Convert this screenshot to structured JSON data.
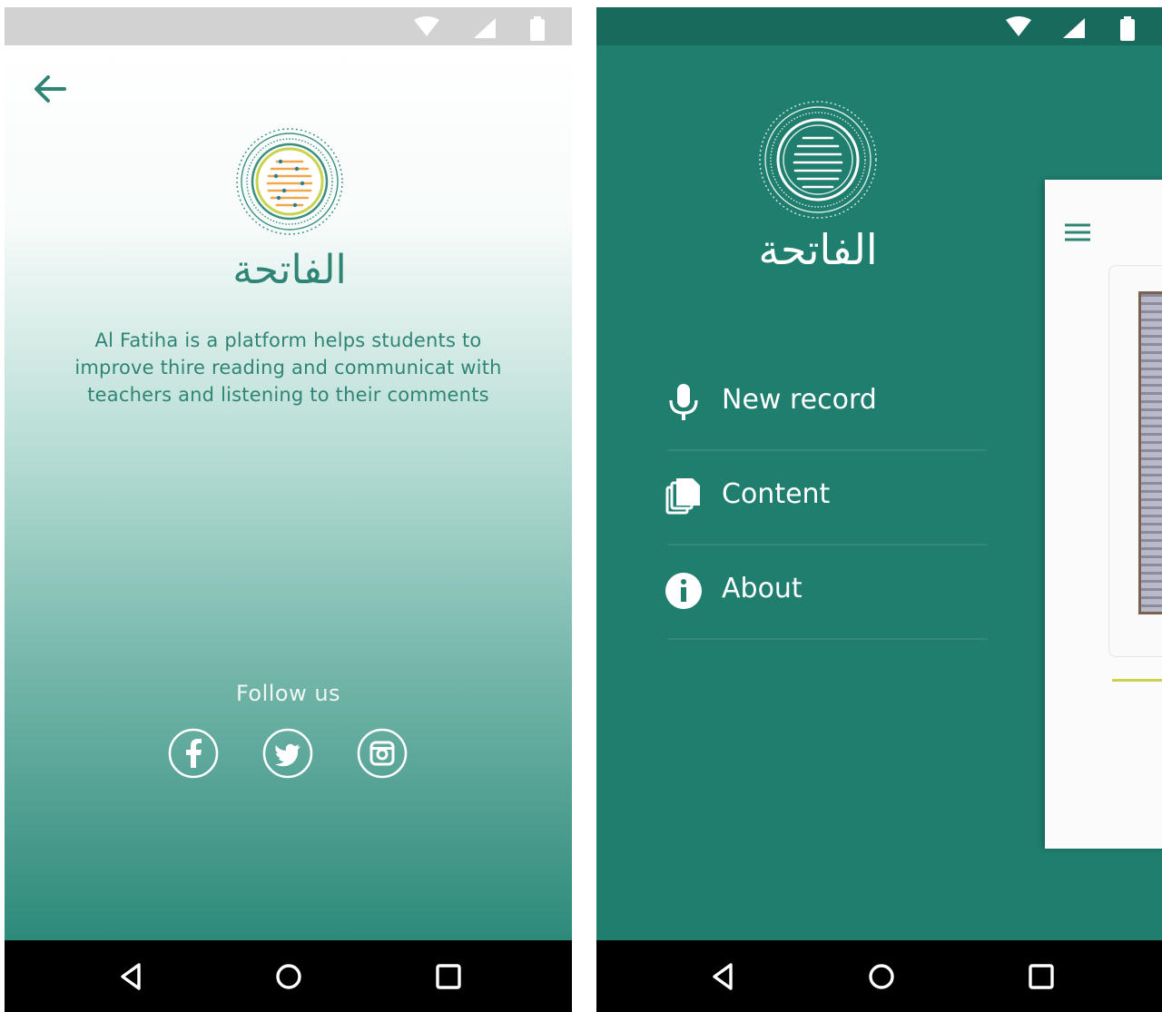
{
  "left_screen": {
    "logo": {
      "arabic_title": "الفاتحة"
    },
    "about_text_lines": [
      "Al Fatiha is a platform helps students to",
      "improve thire reading and communicat with",
      "teachers and listening to their comments"
    ],
    "follow_label": "Follow us",
    "social_icons": [
      "facebook-icon",
      "twitter-icon",
      "instagram-icon"
    ]
  },
  "right_screen": {
    "logo": {
      "arabic_title": "الفاتحة"
    },
    "menu": [
      {
        "label": "New record",
        "icon": "microphone-icon"
      },
      {
        "label": "Content",
        "icon": "copy-icon"
      },
      {
        "label": "About",
        "icon": "info-icon"
      }
    ]
  },
  "colors": {
    "brand_green": "#1f7e6e",
    "status_bar_dark": "#186a5c",
    "accent_orange": "#f0a74a",
    "accent_lime": "#c9d34d"
  }
}
